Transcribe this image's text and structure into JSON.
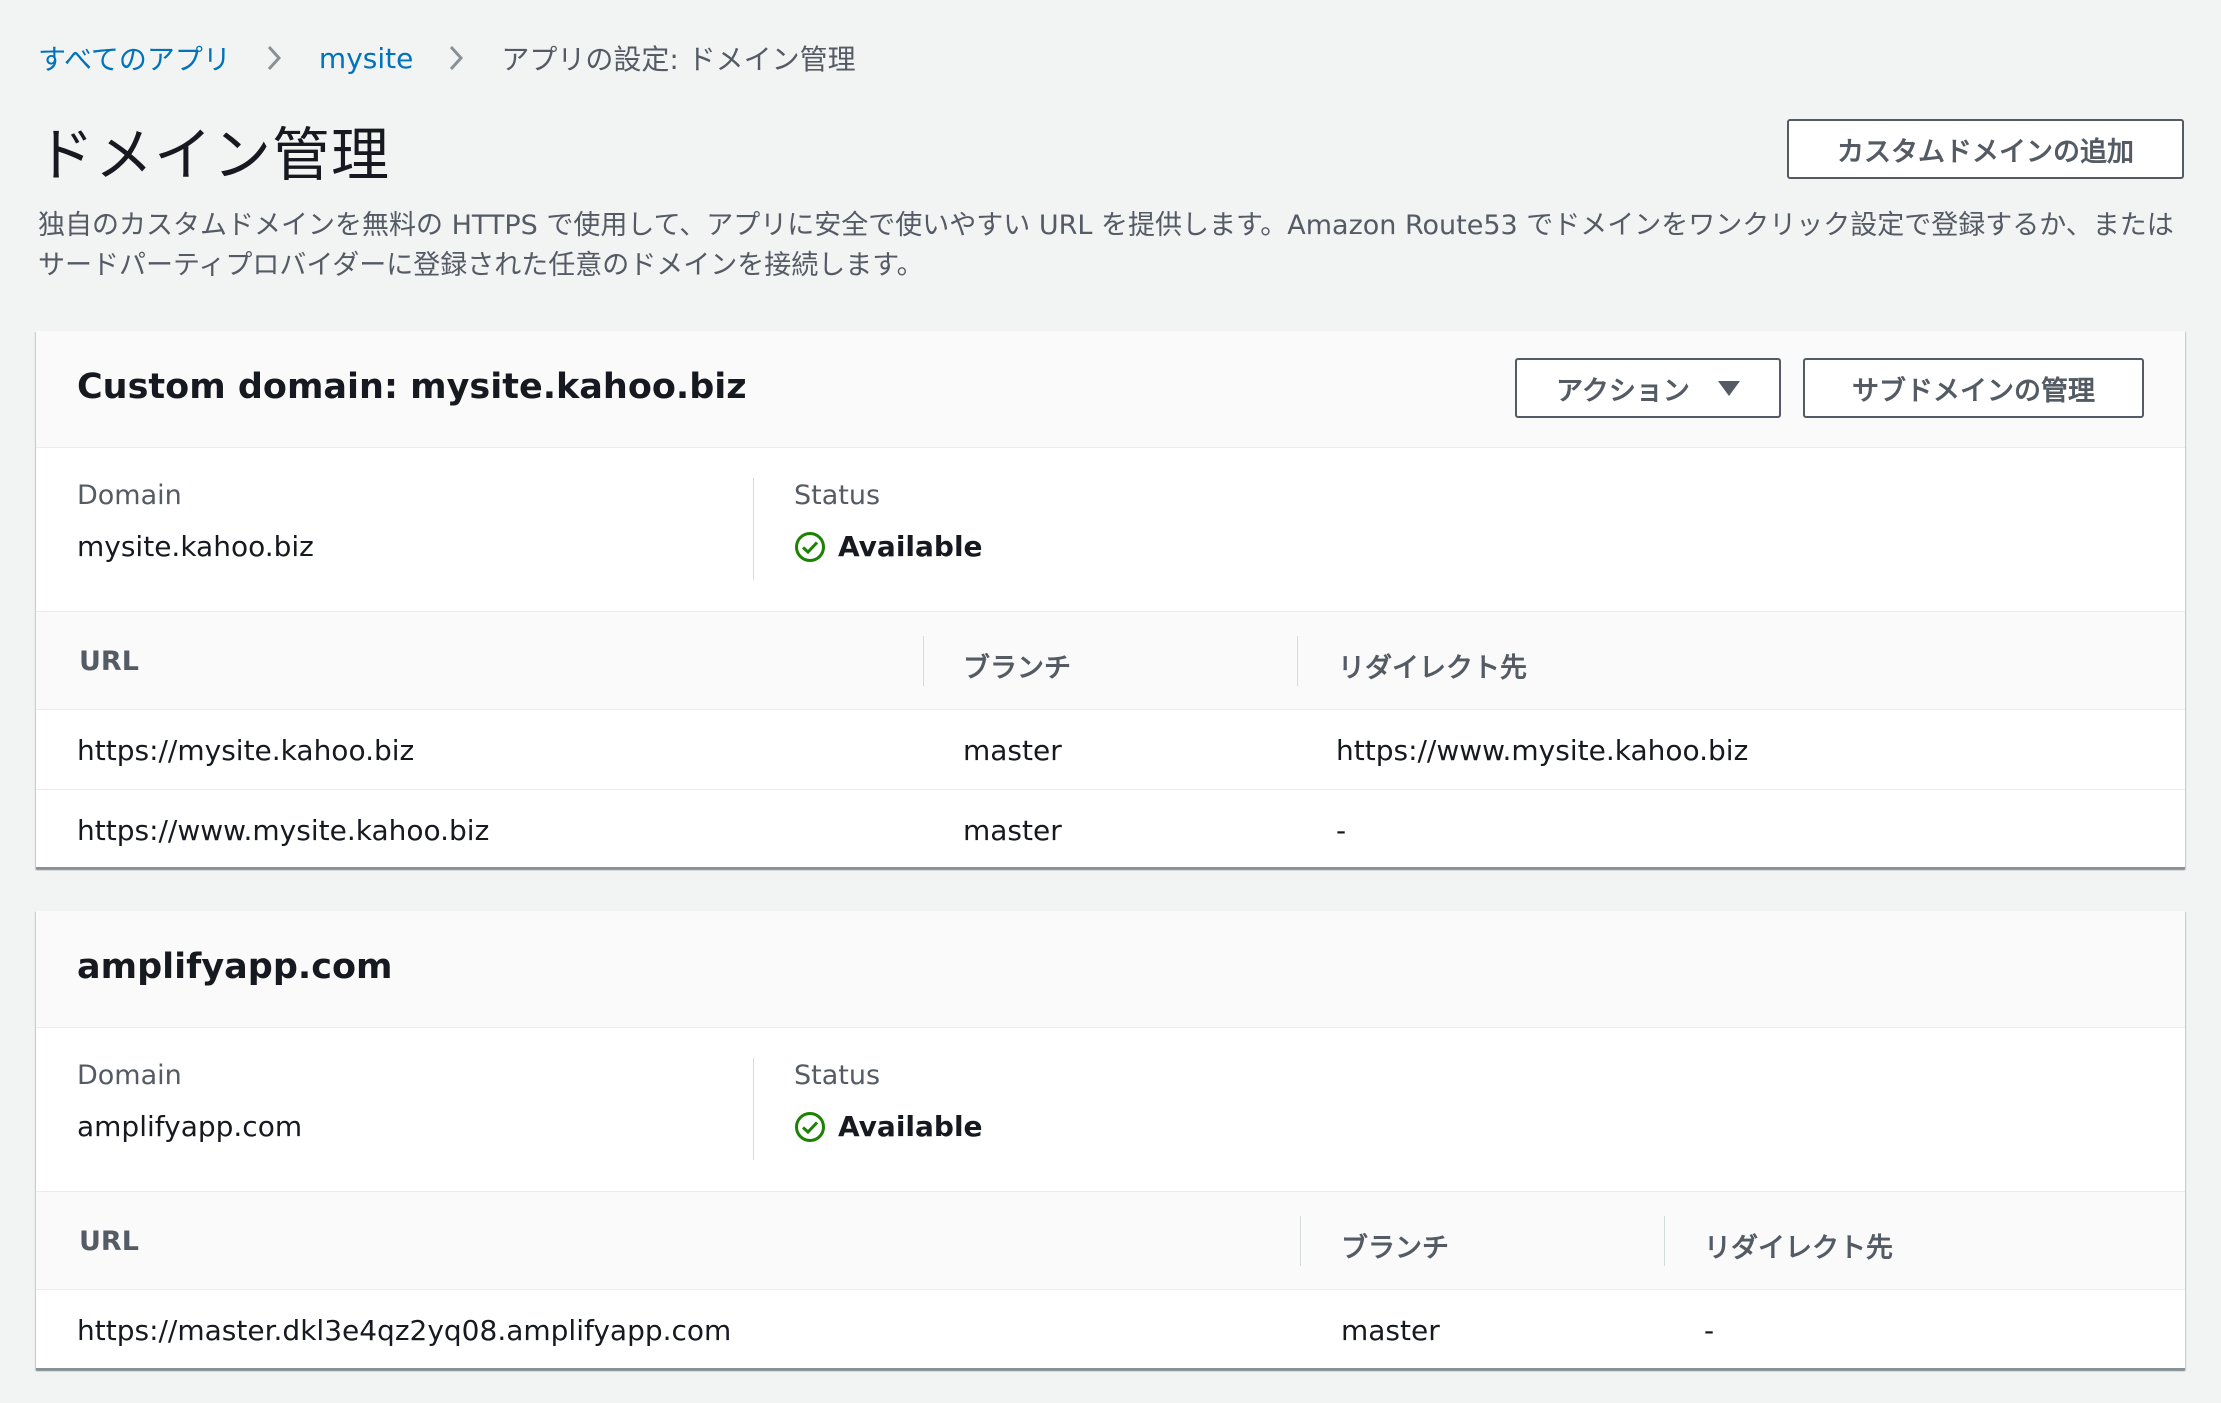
{
  "breadcrumb": {
    "items": [
      "すべてのアプリ",
      "mysite"
    ],
    "current": "アプリの設定: ドメイン管理"
  },
  "header": {
    "title": "ドメイン管理",
    "add_button": "カスタムドメインの追加",
    "description": "独自のカスタムドメインを無料の HTTPS で使用して、アプリに安全で使いやすい URL を提供します。Amazon Route53 でドメインをワンクリック設定で登録するか、またはサードパーティプロバイダーに登録された任意のドメインを接続します。"
  },
  "labels": {
    "domain": "Domain",
    "status": "Status",
    "col_url": "URL",
    "col_branch": "ブランチ",
    "col_redirect": "リダイレクト先"
  },
  "colors": {
    "link": "#0073bb",
    "available": "#1d8102",
    "border": "#545b64"
  },
  "custom_domain": {
    "title": "Custom domain: mysite.kahoo.biz",
    "actions_button": "アクション",
    "subdomain_button": "サブドメインの管理",
    "domain": "mysite.kahoo.biz",
    "status": "Available",
    "status_icon": "check-circle-icon",
    "rows": [
      {
        "url": "https://mysite.kahoo.biz",
        "branch": "master",
        "redirect": "https://www.mysite.kahoo.biz"
      },
      {
        "url": "https://www.mysite.kahoo.biz",
        "branch": "master",
        "redirect": "-"
      }
    ]
  },
  "amplify_domain": {
    "title": "amplifyapp.com",
    "domain": "amplifyapp.com",
    "status": "Available",
    "status_icon": "check-circle-icon",
    "rows": [
      {
        "url": "https://master.dkl3e4qz2yq08.amplifyapp.com",
        "branch": "master",
        "redirect": "-"
      }
    ]
  }
}
